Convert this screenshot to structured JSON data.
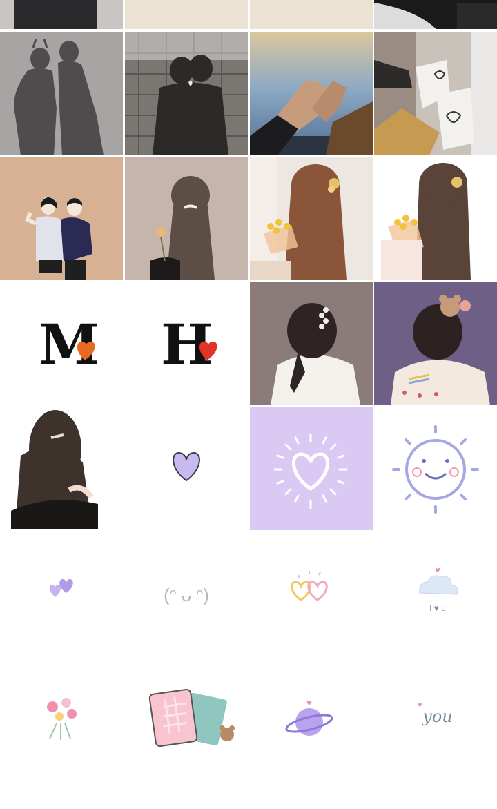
{
  "gallery": {
    "title": "",
    "letters": {
      "m": "M",
      "h": "H"
    },
    "sticker_you": "you",
    "sticker_i_u": "I ♥ u",
    "sticker_face": "(ᵔ ᴗ ᵔ)",
    "watermark": ""
  },
  "tiles": [
    {
      "name": "shadow-couple-top-1"
    },
    {
      "name": "beige-plain-top-2"
    },
    {
      "name": "beige-plain-top-3"
    },
    {
      "name": "bw-photo-top-4"
    },
    {
      "name": "shadow-couple-street"
    },
    {
      "name": "shadow-couple-cobblestone"
    },
    {
      "name": "holding-hands-sky"
    },
    {
      "name": "coffee-cups-hearts"
    },
    {
      "name": "illustrated-couple"
    },
    {
      "name": "girl-back-flower"
    },
    {
      "name": "girl-long-hair-flowers"
    },
    {
      "name": "girl-long-hair-flowers-white"
    },
    {
      "name": "letter-m-heart"
    },
    {
      "name": "letter-h-heart"
    },
    {
      "name": "girl-hair-clip"
    },
    {
      "name": "girl-bear-clip"
    },
    {
      "name": "girl-black-top"
    },
    {
      "name": "purple-heart-small"
    },
    {
      "name": "purple-heart-sunburst"
    },
    {
      "name": "smiling-sun"
    },
    {
      "name": "two-purple-hearts"
    },
    {
      "name": "kawaii-face"
    },
    {
      "name": "double-hearts"
    },
    {
      "name": "cloud-i-love-u"
    },
    {
      "name": "flower-bouquet"
    },
    {
      "name": "notebook-bear"
    },
    {
      "name": "purple-planet"
    },
    {
      "name": "you-text"
    }
  ]
}
